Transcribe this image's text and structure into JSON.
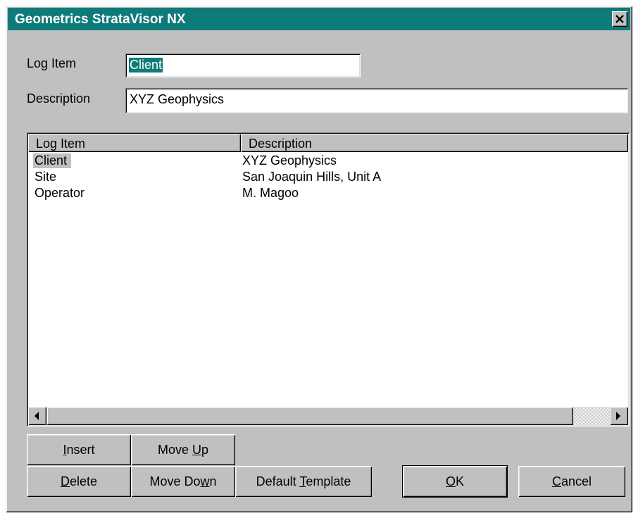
{
  "window": {
    "title": "Geometrics StrataVisor NX",
    "close_glyph": "✕"
  },
  "form": {
    "log_item_label": "Log Item",
    "log_item_value": "Client",
    "description_label": "Description",
    "description_value": "XYZ Geophysics"
  },
  "list": {
    "columns": [
      "Log Item",
      "Description"
    ],
    "rows": [
      {
        "log_item": "Client",
        "description": "XYZ Geophysics",
        "selected": true
      },
      {
        "log_item": "Site",
        "description": "San Joaquin Hills, Unit A",
        "selected": false
      },
      {
        "log_item": "Operator",
        "description": "M. Magoo",
        "selected": false
      }
    ]
  },
  "buttons": {
    "insert": {
      "pre": "",
      "key": "I",
      "post": "nsert"
    },
    "move_up": {
      "pre": "Move ",
      "key": "U",
      "post": "p"
    },
    "delete": {
      "pre": "",
      "key": "D",
      "post": "elete"
    },
    "move_down": {
      "pre": "Move Do",
      "key": "w",
      "post": "n"
    },
    "default_template": {
      "pre": "Default ",
      "key": "T",
      "post": "emplate"
    },
    "ok": {
      "pre": "",
      "key": "O",
      "post": "K"
    },
    "cancel": {
      "pre": "",
      "key": "C",
      "post": "ancel"
    }
  }
}
